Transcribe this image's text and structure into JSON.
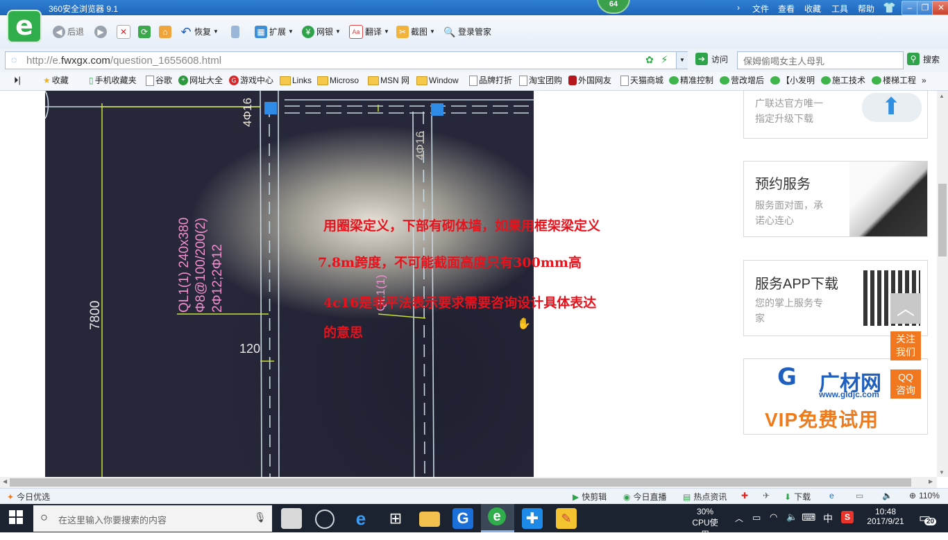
{
  "window": {
    "title": "360安全浏览器 9.1",
    "badge": "64",
    "menu": [
      "文件",
      "查看",
      "收藏",
      "工具",
      "帮助"
    ]
  },
  "toolbar": {
    "logo_glyph": "e",
    "back": "后退",
    "restore": "恢复",
    "extend": "扩展",
    "bank": "网银",
    "translate": "翻译",
    "screenshot": "截图",
    "login_manager": "登录管家"
  },
  "address": {
    "url_prefix": "http://e.",
    "url_domain": "fwxgx.com",
    "url_path": "/question_1655608.html",
    "go_label": "访问"
  },
  "search": {
    "placeholder": "保姆偷喝女主人母乳",
    "button": "搜索"
  },
  "bookmarks": [
    "收藏",
    "手机收藏夹",
    "谷歌",
    "网址大全",
    "游戏中心",
    "Links",
    "Microso",
    "MSN 网",
    "Window",
    "品牌打折",
    "淘宝团购",
    "外国网友",
    "天猫商城",
    "精准控制",
    "营改增后",
    "【小发明",
    "施工技术",
    "楼梯工程"
  ],
  "content": {
    "drawing_labels": {
      "rebar_top_left": "4Φ16",
      "rebar_top_right": "4Φ16",
      "beam_id": "QL1(1) 240x380",
      "stirrup": "Φ8@100/200(2)",
      "bars": "2Φ12;2Φ12",
      "span": "7800",
      "thickness": "120",
      "beam_id_right": "QL1(1)"
    },
    "annotations": [
      "用圈梁定义，下部有砌体墙，如果用框架梁定义",
      "7.8m跨度，不可能截面高度只有300mm高",
      "4c16是非平法表示要求需要咨询设计具体表达",
      "的意思"
    ]
  },
  "sidebar": {
    "upgrade": {
      "line1": "广联达官方唯一",
      "line2": "指定升级下载"
    },
    "service": {
      "title": "预约服务",
      "line1": "服务面对面，承",
      "line2": "诺心连心"
    },
    "app": {
      "title": "服务APP下载",
      "line1": "您的掌上服务专",
      "line2": "家"
    },
    "ad": {
      "brand": "广材网",
      "url": "www.gldjc.com",
      "vip": "VIP免费试用"
    },
    "follow_btn": [
      "关注",
      "我们"
    ],
    "qq_btn": [
      "QQ",
      "咨询"
    ]
  },
  "statusbar": {
    "left": "今日优选",
    "items": [
      "快剪辑",
      "今日直播",
      "热点资讯",
      "下载"
    ],
    "zoom": "110%"
  },
  "taskbar": {
    "search_placeholder": "在这里输入你要搜索的内容",
    "cpu_pct": "30%",
    "cpu_label": "CPU使用",
    "ime": "中",
    "time": "10:48",
    "date": "2017/9/21",
    "notifications": "20"
  },
  "colors": {
    "accent_blue": "#2f7fd3",
    "annotation_red": "#e8121c",
    "side_orange": "#f2781f",
    "taskbar": "#1b2330"
  }
}
